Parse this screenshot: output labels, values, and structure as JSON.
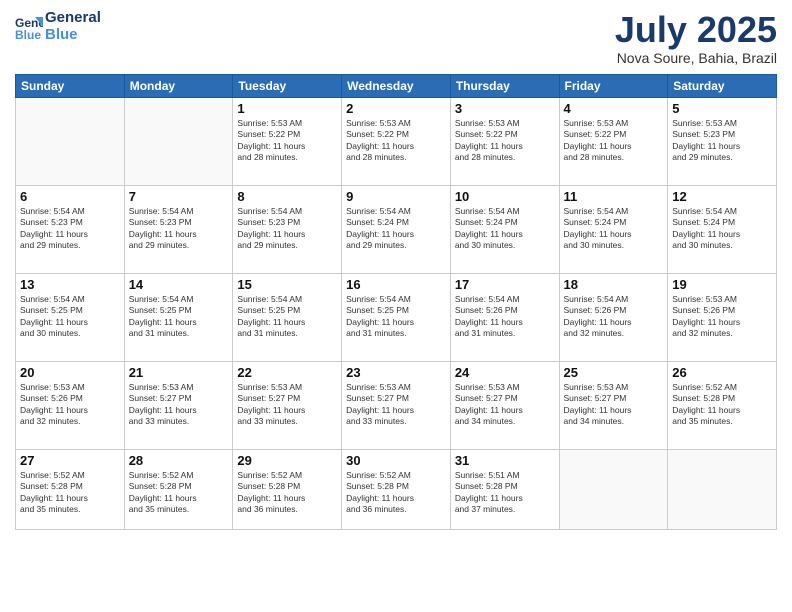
{
  "header": {
    "logo_line1": "General",
    "logo_line2": "Blue",
    "month": "July 2025",
    "location": "Nova Soure, Bahia, Brazil"
  },
  "weekdays": [
    "Sunday",
    "Monday",
    "Tuesday",
    "Wednesday",
    "Thursday",
    "Friday",
    "Saturday"
  ],
  "weeks": [
    [
      {
        "day": "",
        "info": ""
      },
      {
        "day": "",
        "info": ""
      },
      {
        "day": "1",
        "info": "Sunrise: 5:53 AM\nSunset: 5:22 PM\nDaylight: 11 hours\nand 28 minutes."
      },
      {
        "day": "2",
        "info": "Sunrise: 5:53 AM\nSunset: 5:22 PM\nDaylight: 11 hours\nand 28 minutes."
      },
      {
        "day": "3",
        "info": "Sunrise: 5:53 AM\nSunset: 5:22 PM\nDaylight: 11 hours\nand 28 minutes."
      },
      {
        "day": "4",
        "info": "Sunrise: 5:53 AM\nSunset: 5:22 PM\nDaylight: 11 hours\nand 28 minutes."
      },
      {
        "day": "5",
        "info": "Sunrise: 5:53 AM\nSunset: 5:23 PM\nDaylight: 11 hours\nand 29 minutes."
      }
    ],
    [
      {
        "day": "6",
        "info": "Sunrise: 5:54 AM\nSunset: 5:23 PM\nDaylight: 11 hours\nand 29 minutes."
      },
      {
        "day": "7",
        "info": "Sunrise: 5:54 AM\nSunset: 5:23 PM\nDaylight: 11 hours\nand 29 minutes."
      },
      {
        "day": "8",
        "info": "Sunrise: 5:54 AM\nSunset: 5:23 PM\nDaylight: 11 hours\nand 29 minutes."
      },
      {
        "day": "9",
        "info": "Sunrise: 5:54 AM\nSunset: 5:24 PM\nDaylight: 11 hours\nand 29 minutes."
      },
      {
        "day": "10",
        "info": "Sunrise: 5:54 AM\nSunset: 5:24 PM\nDaylight: 11 hours\nand 30 minutes."
      },
      {
        "day": "11",
        "info": "Sunrise: 5:54 AM\nSunset: 5:24 PM\nDaylight: 11 hours\nand 30 minutes."
      },
      {
        "day": "12",
        "info": "Sunrise: 5:54 AM\nSunset: 5:24 PM\nDaylight: 11 hours\nand 30 minutes."
      }
    ],
    [
      {
        "day": "13",
        "info": "Sunrise: 5:54 AM\nSunset: 5:25 PM\nDaylight: 11 hours\nand 30 minutes."
      },
      {
        "day": "14",
        "info": "Sunrise: 5:54 AM\nSunset: 5:25 PM\nDaylight: 11 hours\nand 31 minutes."
      },
      {
        "day": "15",
        "info": "Sunrise: 5:54 AM\nSunset: 5:25 PM\nDaylight: 11 hours\nand 31 minutes."
      },
      {
        "day": "16",
        "info": "Sunrise: 5:54 AM\nSunset: 5:25 PM\nDaylight: 11 hours\nand 31 minutes."
      },
      {
        "day": "17",
        "info": "Sunrise: 5:54 AM\nSunset: 5:26 PM\nDaylight: 11 hours\nand 31 minutes."
      },
      {
        "day": "18",
        "info": "Sunrise: 5:54 AM\nSunset: 5:26 PM\nDaylight: 11 hours\nand 32 minutes."
      },
      {
        "day": "19",
        "info": "Sunrise: 5:53 AM\nSunset: 5:26 PM\nDaylight: 11 hours\nand 32 minutes."
      }
    ],
    [
      {
        "day": "20",
        "info": "Sunrise: 5:53 AM\nSunset: 5:26 PM\nDaylight: 11 hours\nand 32 minutes."
      },
      {
        "day": "21",
        "info": "Sunrise: 5:53 AM\nSunset: 5:27 PM\nDaylight: 11 hours\nand 33 minutes."
      },
      {
        "day": "22",
        "info": "Sunrise: 5:53 AM\nSunset: 5:27 PM\nDaylight: 11 hours\nand 33 minutes."
      },
      {
        "day": "23",
        "info": "Sunrise: 5:53 AM\nSunset: 5:27 PM\nDaylight: 11 hours\nand 33 minutes."
      },
      {
        "day": "24",
        "info": "Sunrise: 5:53 AM\nSunset: 5:27 PM\nDaylight: 11 hours\nand 34 minutes."
      },
      {
        "day": "25",
        "info": "Sunrise: 5:53 AM\nSunset: 5:27 PM\nDaylight: 11 hours\nand 34 minutes."
      },
      {
        "day": "26",
        "info": "Sunrise: 5:52 AM\nSunset: 5:28 PM\nDaylight: 11 hours\nand 35 minutes."
      }
    ],
    [
      {
        "day": "27",
        "info": "Sunrise: 5:52 AM\nSunset: 5:28 PM\nDaylight: 11 hours\nand 35 minutes."
      },
      {
        "day": "28",
        "info": "Sunrise: 5:52 AM\nSunset: 5:28 PM\nDaylight: 11 hours\nand 35 minutes."
      },
      {
        "day": "29",
        "info": "Sunrise: 5:52 AM\nSunset: 5:28 PM\nDaylight: 11 hours\nand 36 minutes."
      },
      {
        "day": "30",
        "info": "Sunrise: 5:52 AM\nSunset: 5:28 PM\nDaylight: 11 hours\nand 36 minutes."
      },
      {
        "day": "31",
        "info": "Sunrise: 5:51 AM\nSunset: 5:28 PM\nDaylight: 11 hours\nand 37 minutes."
      },
      {
        "day": "",
        "info": ""
      },
      {
        "day": "",
        "info": ""
      }
    ]
  ]
}
